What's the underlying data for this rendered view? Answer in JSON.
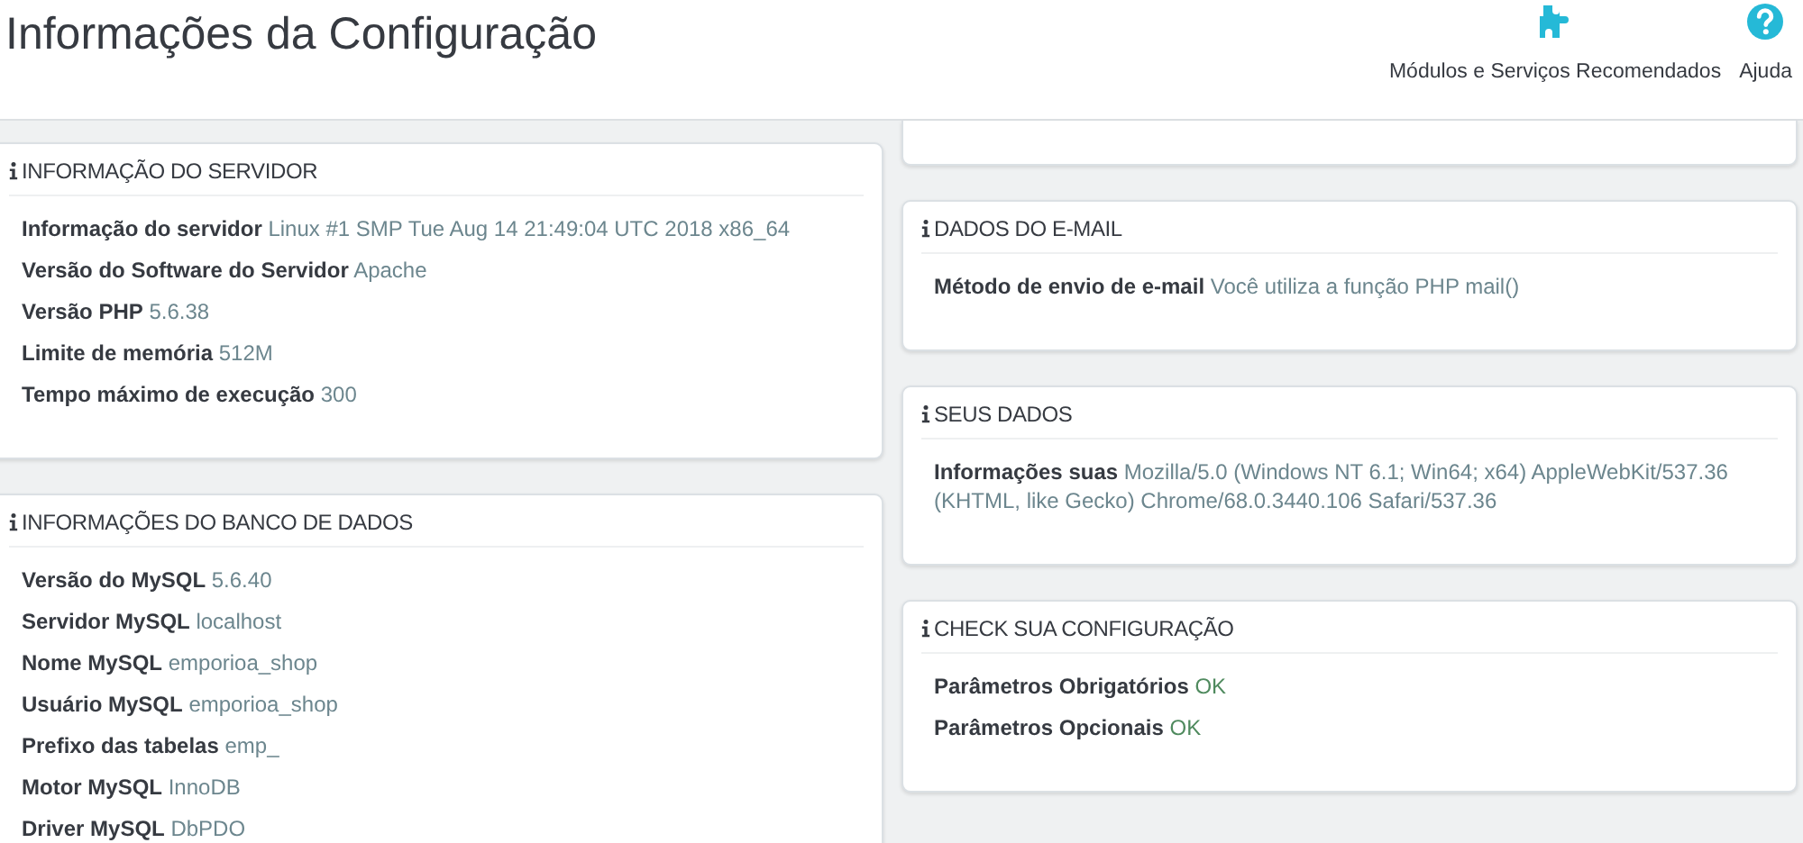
{
  "page": {
    "title": "Informações da Configuração"
  },
  "toolbar": [
    {
      "kind": "modules",
      "label": "Módulos e Serviços Recomendados"
    },
    {
      "kind": "help",
      "label": "Ajuda"
    }
  ],
  "columns": [
    {
      "cards": [
        {
          "title": "INFORMAÇÃO DO SERVIDOR",
          "rows": [
            {
              "label": "Informação do servidor",
              "value": "Linux #1 SMP Tue Aug 14 21:49:04 UTC 2018 x86_64"
            },
            {
              "label": "Versão do Software do Servidor",
              "value": "Apache"
            },
            {
              "label": "Versão PHP",
              "value": "5.6.38"
            },
            {
              "label": "Limite de memória",
              "value": "512M"
            },
            {
              "label": "Tempo máximo de execução",
              "value": "300"
            }
          ]
        },
        {
          "title": "INFORMAÇÕES DO BANCO DE DADOS",
          "rows": [
            {
              "label": "Versão do MySQL",
              "value": "5.6.40"
            },
            {
              "label": "Servidor MySQL",
              "value": "localhost"
            },
            {
              "label": "Nome MySQL",
              "value": "emporioa_shop"
            },
            {
              "label": "Usuário MySQL",
              "value": "emporioa_shop"
            },
            {
              "label": "Prefixo das tabelas",
              "value": "emp_"
            },
            {
              "label": "Motor MySQL",
              "value": "InnoDB"
            },
            {
              "label": "Driver MySQL",
              "value": "DbPDO"
            }
          ]
        }
      ]
    },
    {
      "cards": [
        {
          "kind": "partial"
        },
        {
          "title": "DADOS DO E-MAIL",
          "rows": [
            {
              "label": "Método de envio de e-mail",
              "value": "Você utiliza a função PHP mail()"
            }
          ]
        },
        {
          "title": "SEUS DADOS",
          "rows": [
            {
              "label": "Informações suas",
              "value": "Mozilla/5.0 (Windows NT 6.1; Win64; x64) AppleWebKit/537.36 (KHTML, like Gecko) Chrome/68.0.3440.106 Safari/537.36"
            }
          ]
        },
        {
          "title": "CHECK SUA CONFIGURAÇÃO",
          "rows": [
            {
              "label": "Parâmetros Obrigatórios",
              "value": "OK",
              "ok": true
            },
            {
              "label": "Parâmetros Opcionais",
              "value": "OK",
              "ok": true
            }
          ]
        }
      ]
    }
  ]
}
